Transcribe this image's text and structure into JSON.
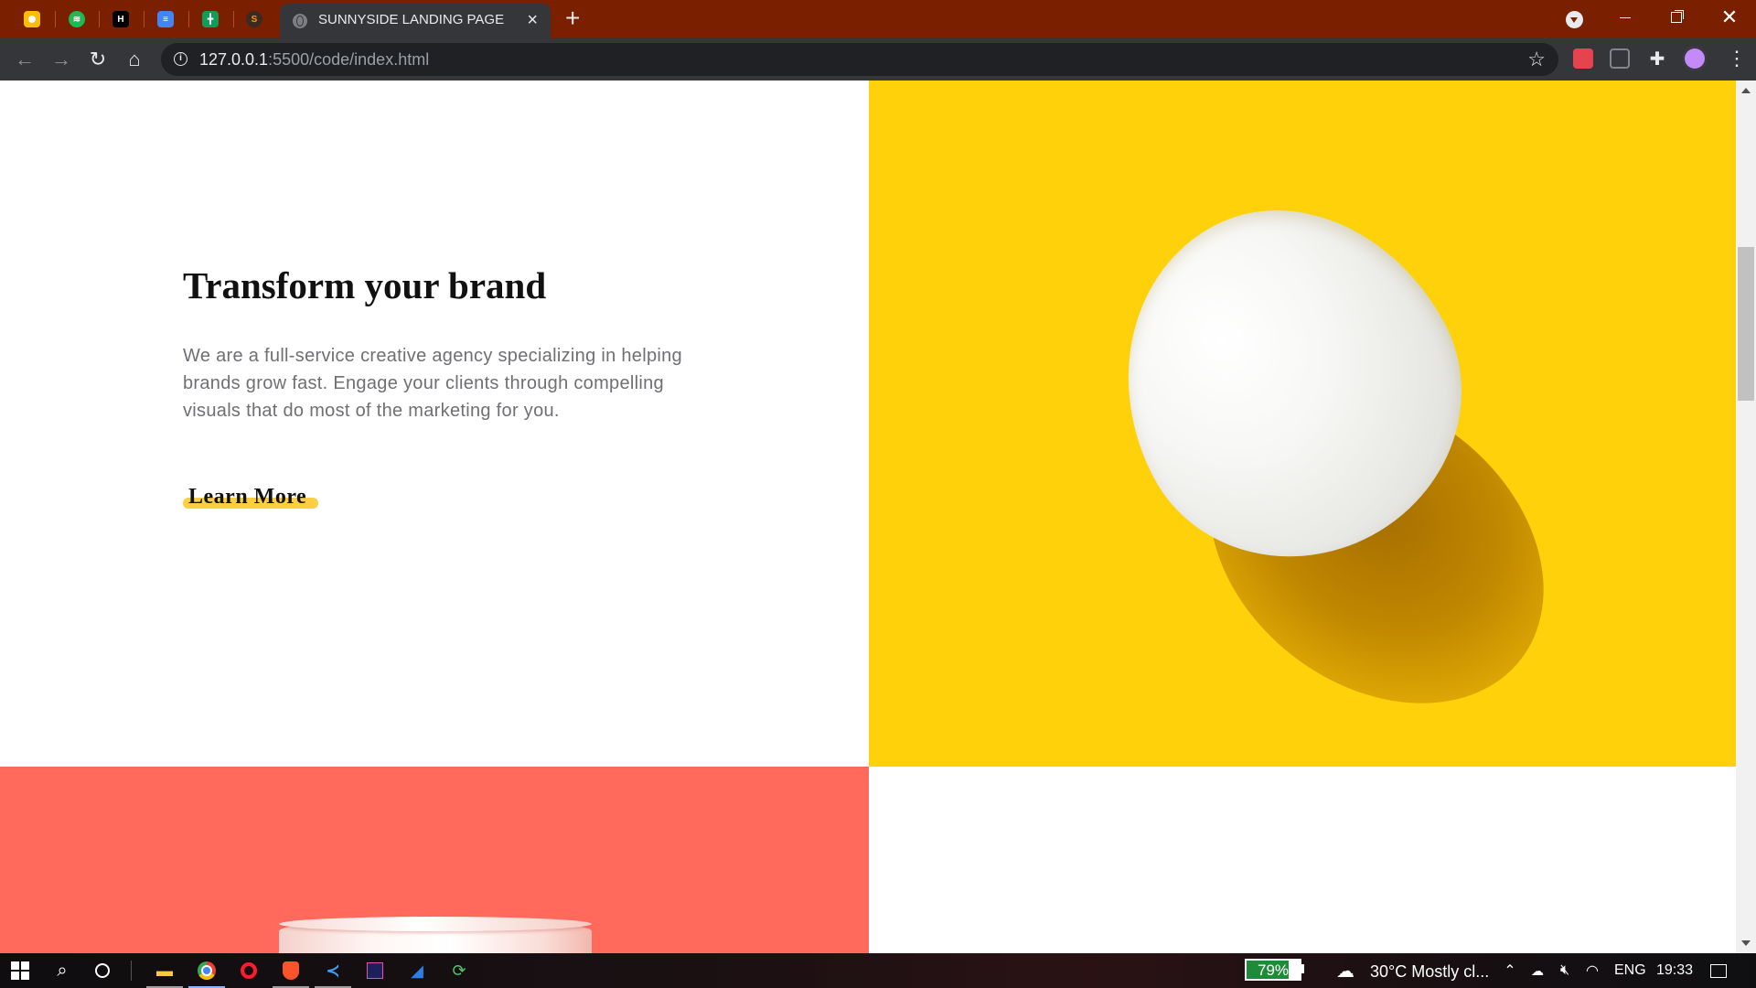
{
  "browser": {
    "tab_title": "SUNNYSIDE LANDING PAGE",
    "tab_close": "×",
    "new_tab": "+",
    "url_host": "127.0.0.1",
    "url_rest": ":5500/code/index.html",
    "pinned_tabs": [
      "Google Keep",
      "Spotify",
      "Hacker News",
      "Google Docs",
      "Google Sheets",
      "Sublime"
    ]
  },
  "page": {
    "heading": "Transform your brand",
    "paragraph": "We are a full-service creative agency specializing in helping brands grow fast. Engage your clients through compelling visuals that do most of the marketing for you.",
    "cta": "Learn More",
    "colors": {
      "hero_image_bg": "#fed10a",
      "cta_underline": "#fdcd42",
      "coral_section": "#ff6a5c"
    }
  },
  "taskbar": {
    "battery": "79%",
    "weather": "30°C  Mostly cl...",
    "language": "ENG",
    "time": "19:33"
  }
}
